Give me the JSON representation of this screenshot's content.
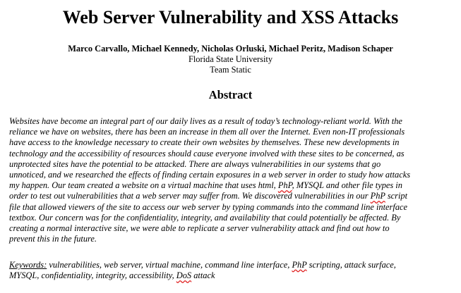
{
  "paper": {
    "title": "Web Server Vulnerability and XSS Attacks",
    "authors": "Marco Carvallo, Michael Kennedy, Nicholas Orluski, Michael Peritz, Madison Schaper",
    "university": "Florida State University",
    "team": "Team Static",
    "abstract_heading": "Abstract",
    "abstract_lines": [
      "Websites have become an integral part of our daily lives as a result of today’s technology-reliant world. With the",
      "reliance we have on websites, there has been an increase in them all over the Internet. Even non-IT professionals",
      "have access to the knowledge necessary to create their own websites by themselves. These new developments in",
      "technology and the accessibility of resources should cause everyone involved with these sites to be concerned, as",
      "unprotected sites have the potential to be attacked. There are always vulnerabilities in our systems that go",
      "unnoticed, and we researched the effects of finding certain exposures in a web server in order to study how attacks",
      "my happen. Our team created a website on a virtual machine that uses html, ",
      "PhP",
      ", MYSQL and other file types in",
      "order to test out vulnerabilities that a web server may suffer from. We discovered vulnerabilities in our ",
      "PhP",
      " script",
      "file that allowed viewers of the site to access our web server by typing commands into the command line interface",
      "textbox. Our concern was for the confidentiality, integrity, and availability that could potentially be affected. By",
      "creating a normal interactive site, we were able to replicate a server vulnerability attack and find out how to",
      "prevent this in the future."
    ],
    "keywords_label": "Keywords:",
    "keywords_line1_a": " vulnerabilities, web server, virtual machine, command line interface, ",
    "keywords_line1_b": "PhP",
    "keywords_line1_c": " scripting, attack surface,",
    "keywords_line2_a": "MYSQL, confidentiality, integrity, accessibility, ",
    "keywords_line2_b": "DoS",
    "keywords_line2_c": " attack",
    "spellcheck_color": "#e02020"
  }
}
